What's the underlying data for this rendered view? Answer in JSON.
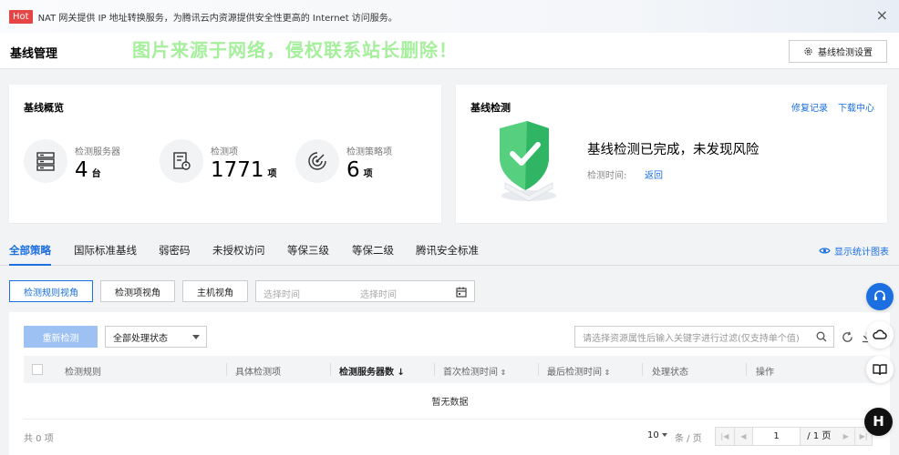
{
  "banner": {
    "badge": "Hot",
    "text": "NAT 网关提供 IP 地址转换服务，为腾讯云内资源提供安全性更高的 Internet 访问服务。",
    "close_icon": "×"
  },
  "header": {
    "title": "基线管理",
    "watermark": "图片来源于网络，侵权联系站长删除！",
    "settings_button": "基线检测设置"
  },
  "overview": {
    "title": "基线概览",
    "stats": [
      {
        "label": "检测服务器",
        "value": "4",
        "unit": "台",
        "icon": "server-icon"
      },
      {
        "label": "检测项",
        "value": "1771",
        "unit": "项",
        "icon": "checklist-icon"
      },
      {
        "label": "检测策略项",
        "value": "6",
        "unit": "项",
        "icon": "radar-icon"
      }
    ]
  },
  "detection": {
    "title": "基线检测",
    "repair_link": "修复记录",
    "download_link": "下载中心",
    "status_text": "基线检测已完成，未发现风险",
    "time_label": "检测时间:",
    "back_link": "返回",
    "shield_icon": "shield-check-icon"
  },
  "tabs": {
    "items": [
      "全部策略",
      "国际标准基线",
      "弱密码",
      "未授权访问",
      "等保三级",
      "等保二级",
      "腾讯安全标准"
    ],
    "toggle_chart": "显示统计图表"
  },
  "views": {
    "items": [
      "检测规则视角",
      "检测项视角",
      "主机视角"
    ],
    "start_placeholder": "选择时间",
    "end_placeholder": "选择时间"
  },
  "table": {
    "rescan_button": "重新检测",
    "status_select": "全部处理状态",
    "search_placeholder": "请选择资源属性后输入关键字进行过滤(仅支持单个值)",
    "columns": [
      "检测规则",
      "具体检测项",
      "检测服务器数",
      "首次检测时间",
      "最后检测时间",
      "处理状态",
      "操作"
    ],
    "empty_text": "暂无数据",
    "total": "共 0 项",
    "page_size": "10",
    "per_page": "条 / 页",
    "page_value": "1",
    "page_total": "/ 1 页"
  },
  "colors": {
    "accent": "#1c6fe0",
    "badge": "#e54545",
    "watermark": "#a6ef9d",
    "shield": "#3dc46b"
  }
}
